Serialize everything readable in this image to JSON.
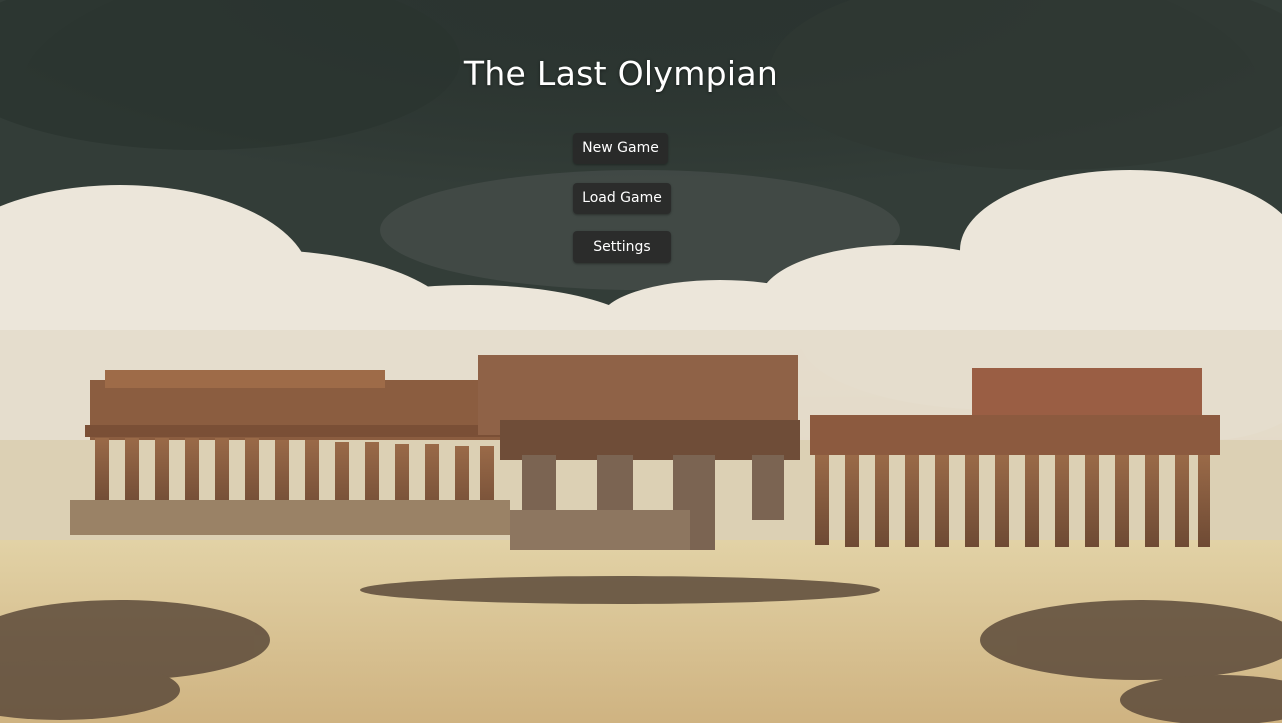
{
  "game": {
    "title": "The Last Olympian"
  },
  "menu": {
    "new_game_label": "New Game",
    "load_game_label": "Load Game",
    "settings_label": "Settings"
  },
  "colors": {
    "button_background": "#282828",
    "button_text": "#ffffff",
    "title_text": "#ffffff",
    "storm_sky": "#3b4541",
    "clouds": "#e8e1d2",
    "sand": "#d9c597",
    "ruins": "#8a5a3c"
  }
}
